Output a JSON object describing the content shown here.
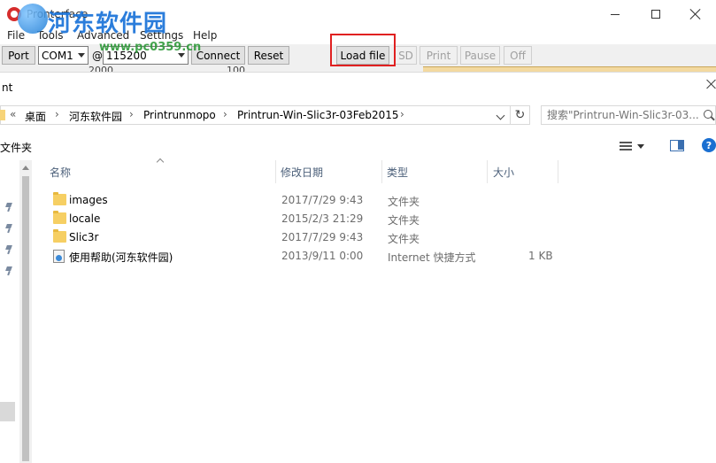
{
  "app": {
    "title": "Pronterface",
    "watermark_text": "河东软件园",
    "watermark_url": "www.pc0359.cn"
  },
  "menu": [
    "File",
    "Tools",
    "Advanced",
    "Settings",
    "Help"
  ],
  "toolbar": {
    "port_label": "Port",
    "port_value": "COM1",
    "at_symbol": "@",
    "baud_value": "115200",
    "connect_label": "Connect",
    "reset_label": "Reset",
    "load_file_label": "Load file",
    "sd_label": "SD",
    "print_label": "Print",
    "pause_label": "Pause",
    "off_label": "Off"
  },
  "strip": {
    "left_value": "2000",
    "right_value": "100"
  },
  "dialog": {
    "title_fragment": "nt",
    "breadcrumb": [
      "«",
      "桌面",
      "河东软件园",
      "Printrunmopo",
      "Printrun-Win-Slic3r-03Feb2015"
    ],
    "search_placeholder": "搜索\"Printrun-Win-Slic3r-03...",
    "new_folder_label": "文件夹",
    "help_glyph": "?",
    "refresh_glyph": "↻",
    "columns": {
      "name": "名称",
      "date": "修改日期",
      "type": "类型",
      "size": "大小"
    },
    "rows": [
      {
        "name": "images",
        "date": "2017/7/29 9:43",
        "type": "文件夹",
        "size": "",
        "icon": "folder-icon"
      },
      {
        "name": "locale",
        "date": "2015/2/3 21:29",
        "type": "文件夹",
        "size": "",
        "icon": "folder-icon"
      },
      {
        "name": "Slic3r",
        "date": "2017/7/29 9:43",
        "type": "文件夹",
        "size": "",
        "icon": "folder-icon"
      },
      {
        "name": "使用帮助(河东软件园)",
        "date": "2013/9/11 0:00",
        "type": "Internet 快捷方式",
        "size": "1 KB",
        "icon": "internet-shortcut-icon"
      }
    ]
  },
  "colors": {
    "highlight_box": "#e02020",
    "folder": "#f6cf63",
    "column_header_text": "#4c607a",
    "watermark_blue": "#1a73d9",
    "watermark_green": "#2f9a3a"
  }
}
